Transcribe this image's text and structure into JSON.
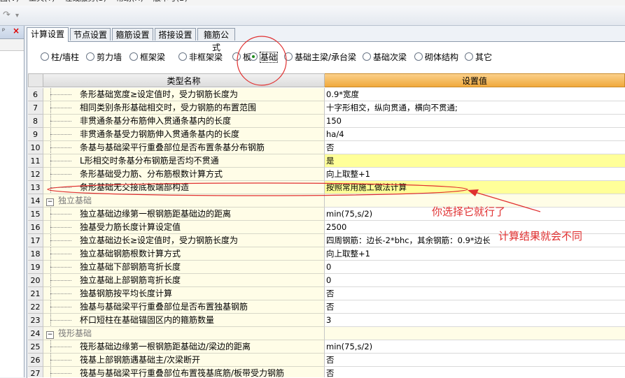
{
  "menu": {
    "items": [
      "图(V)",
      "工具(T)",
      "在线服务(S)",
      "帮助(H)",
      "版本号(B)"
    ]
  },
  "toolbar": {
    "redo_icon": "↷",
    "dropdown_icon": "▾"
  },
  "left_pane": {
    "pin_icon": "ᵖ",
    "close_icon": "×"
  },
  "tabs": [
    {
      "label": "计算设置",
      "active": true
    },
    {
      "label": "节点设置",
      "active": false
    },
    {
      "label": "箍筋设置",
      "active": false
    },
    {
      "label": "搭接设置",
      "active": false
    },
    {
      "label": "箍筋公式",
      "active": false
    }
  ],
  "categories": [
    {
      "label": "柱/墙柱",
      "selected": false
    },
    {
      "label": "剪力墙",
      "selected": false
    },
    {
      "label": "框架梁",
      "selected": false
    },
    {
      "label": "非框架梁",
      "selected": false
    },
    {
      "label": "板",
      "selected": false
    },
    {
      "label": "基础",
      "selected": true
    },
    {
      "label": "基础主梁/承台梁",
      "selected": false
    },
    {
      "label": "基础次梁",
      "selected": false
    },
    {
      "label": "砌体结构",
      "selected": false
    },
    {
      "label": "其它",
      "selected": false
    }
  ],
  "grid": {
    "col_name": "类型名称",
    "col_value": "设置值",
    "rows": [
      {
        "num": "6",
        "name": "条形基础宽度≥设定值时，受力钢筋长度为",
        "value": "0.9*宽度"
      },
      {
        "num": "7",
        "name": "相同类别条形基础相交时，受力钢筋的布置范围",
        "value": "十字形相交，纵向贯通，横向不贯通;"
      },
      {
        "num": "8",
        "name": "非贯通条基分布筋伸入贯通条基内的长度",
        "value": "150"
      },
      {
        "num": "9",
        "name": "非贯通条基受力钢筋伸入贯通条基内的长度",
        "value": "ha/4"
      },
      {
        "num": "10",
        "name": "条基与基础梁平行重叠部位是否布置条基分布钢筋",
        "value": "否"
      },
      {
        "num": "11",
        "name": "L形相交时条基分布钢筋是否均不贯通",
        "value": "是",
        "highlight": true
      },
      {
        "num": "12",
        "name": "条形基础受力筋、分布筋根数计算方式",
        "value": "向上取整+1"
      },
      {
        "num": "13",
        "name": "条形基础无交接底板端部构造",
        "value": "按照常用施工做法计算",
        "highlight": true
      },
      {
        "num": "14",
        "name": "独立基础",
        "value": "",
        "group": true
      },
      {
        "num": "15",
        "name": "独立基础边缘第一根钢筋距基础边的距离",
        "value": "min(75,s/2)"
      },
      {
        "num": "16",
        "name": "独基受力筋长度计算设定值",
        "value": "2500"
      },
      {
        "num": "17",
        "name": "独立基础边长≥设定值时，受力钢筋长度为",
        "value": "四周钢筋：边长-2*bhc，其余钢筋：0.9*边长"
      },
      {
        "num": "18",
        "name": "独立基础钢筋根数计算方式",
        "value": "向上取整+1"
      },
      {
        "num": "19",
        "name": "独立基础下部钢筋弯折长度",
        "value": "0"
      },
      {
        "num": "20",
        "name": "独立基础上部钢筋弯折长度",
        "value": "0"
      },
      {
        "num": "21",
        "name": "独基钢筋按平均长度计算",
        "value": "否"
      },
      {
        "num": "22",
        "name": "独基与基础梁平行重叠部位是否布置独基钢筋",
        "value": "否"
      },
      {
        "num": "23",
        "name": "杯口短柱在基础锚固区内的箍筋数量",
        "value": "3"
      },
      {
        "num": "24",
        "name": "筏形基础",
        "value": "",
        "group": true
      },
      {
        "num": "25",
        "name": "筏形基础边缘第一根钢筋距基础边/梁边的距离",
        "value": "min(75,s/2)"
      },
      {
        "num": "26",
        "name": "筏基上部钢筋遇基础主/次梁断开",
        "value": "否"
      },
      {
        "num": "27",
        "name": "筏基与基础梁平行重叠部位布置筏基底筋/板带受力钢筋",
        "value": "否"
      }
    ]
  },
  "annotations": {
    "note1": "你选择它就行了",
    "note2": "计算结果就会不同"
  },
  "colors": {
    "annotation": "#e03030",
    "header_accent": "#f0a93c",
    "highlight": "#ffff99"
  }
}
